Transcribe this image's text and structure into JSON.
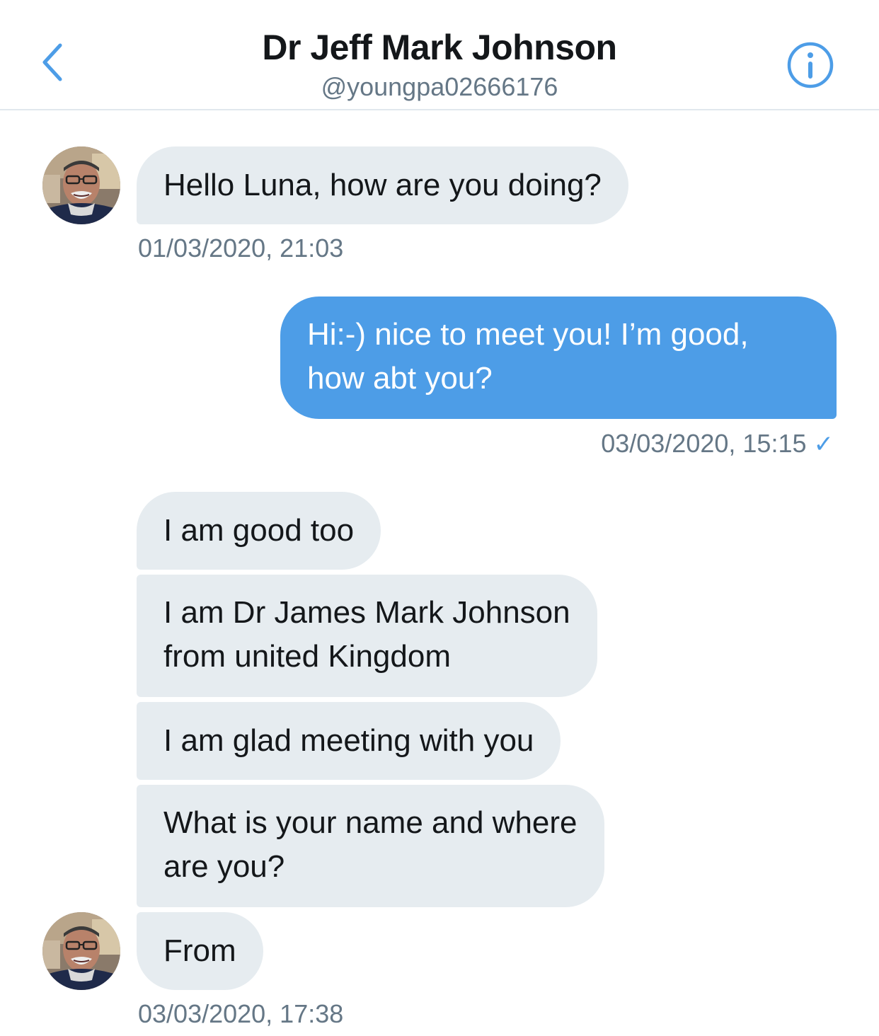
{
  "header": {
    "title": "Dr Jeff Mark Johnson",
    "handle": "@youngpa02666176",
    "back_icon": "chevron-left-icon",
    "info_icon": "info-icon",
    "accent": "#4d9de7"
  },
  "messages": [
    {
      "text": "Hello Luna, how are you doing?",
      "direction": "incoming"
    },
    {
      "text": "Hi:-) nice to meet you! I’m good,",
      "text2": "how abt you?",
      "direction": "outgoing"
    },
    {
      "text": "I am good too",
      "direction": "incoming"
    },
    {
      "text": "I am Dr James Mark Johnson",
      "text2": "from united Kingdom",
      "direction": "incoming"
    },
    {
      "text": "I am glad meeting with you",
      "direction": "incoming"
    },
    {
      "text": "What is your name and where",
      "text2": "are you?",
      "direction": "incoming"
    },
    {
      "text": "From",
      "direction": "incoming"
    }
  ],
  "timestamps": {
    "t1": "01/03/2020, 21:03",
    "t2": "03/03/2020, 15:15",
    "t2_status": "✓",
    "t3": "03/03/2020, 17:38"
  },
  "colors": {
    "incoming_bubble": "#e6ecf0",
    "outgoing_bubble": "#4d9de7",
    "secondary_text": "#657786"
  }
}
